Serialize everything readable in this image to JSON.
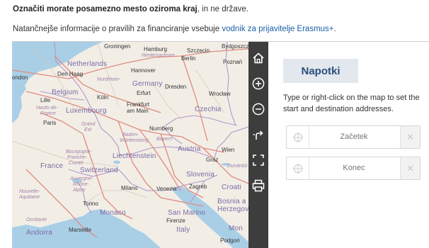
{
  "intro": {
    "bold_text": "Označiti morate posamezno mesto oziroma kraj",
    "rest_text": ", in ne države.",
    "info_prefix": "Natančnejše informacije o pravilih za financiranje vsebuje ",
    "info_link": "vodnik za prijavitelje Erasmus+",
    "info_suffix": "."
  },
  "map": {
    "countries": [
      "Netherlands",
      "Belgium",
      "Luxembourg",
      "Germany",
      "France",
      "Switzerland",
      "Liechtenstein",
      "Austria",
      "Czechia",
      "Slovenia",
      "Croatia",
      "Bosnia and Herzegovina",
      "Italy",
      "Monaco",
      "San Marino",
      "Andorra"
    ],
    "cities": [
      "Groningen",
      "Hamburg",
      "Szczecin",
      "Bydgoszcz",
      "Berlin",
      "Poznań",
      "Den Haag",
      "Hannover",
      "London",
      "Dresden",
      "Wrocław",
      "Lille",
      "Köln",
      "Erfurt",
      "Frankfurt am Main",
      "Paris",
      "Nürnberg",
      "Wien",
      "Graz",
      "Zagreb",
      "Milano",
      "Venezia",
      "Torino",
      "Firenze",
      "Marseille",
      "Podgorica"
    ],
    "regions": [
      "Niedersachsen",
      "Nordrhein-Westfalen",
      "Hauts-de-France",
      "Grand Est",
      "Baden-Württemberg",
      "Bayern",
      "Bourgogne-Franche-Comté",
      "Auvergne-Rhône-Alpes",
      "Nouvelle-Aquitaine",
      "Occitanie",
      "Dunántúl"
    ],
    "labels": {
      "groningen": "Groningen",
      "hamburg": "Hamburg",
      "szczecin": "Szczecin",
      "bydgoszcz": "Bydgoszcz",
      "niedersachsen": "Niedersachsen",
      "berlin": "Berlin",
      "poznan": "Poznań",
      "netherlands": "Netherlands",
      "den_haag": "Den Haag",
      "hannover": "Hannover",
      "london": "ondon",
      "nrw": "Nordrhein-",
      "germany": "Germany",
      "dresden": "Dresden",
      "belgium": "Belgium",
      "lille": "Lille",
      "koln": "Köln",
      "erfurt": "Erfurt",
      "wroclaw": "Wrocław",
      "hauts": "Hauts-de-",
      "hauts2": "France",
      "luxembourg": "Luxembourg",
      "frankfurt": "Frankfurt",
      "frankfurt2": "am Main",
      "czechia": "Czechia",
      "paris": "Paris",
      "grand_est": "Grand",
      "grand_est2": "Est",
      "nurnberg": "Nurnberg",
      "baden": "Baden-",
      "baden2": "Württemberg",
      "bayern": "Bayern",
      "wien": "Wien",
      "bourgogne": "Bourgogne-",
      "bourgogne2": "Franche-",
      "bourgogne3": "Comté",
      "liechtenstein": "Liechtenstein",
      "austria": "Austria",
      "france": "France",
      "switzerland": "Switzerland",
      "graz": "Graz",
      "dunantul": "Dunántúl",
      "slovenia": "Slovenia",
      "auvergne": "Auvergne-",
      "auvergne2": "Rhône-",
      "auvergne3": "Alpes",
      "nouvelle": "Nouvelle-",
      "nouvelle2": "Aquitaine",
      "milano": "Milano",
      "venezia": "Venezia",
      "zagreb": "Zagreb",
      "croatia": "Croati",
      "torino": "Torino",
      "bosnia": "Bosnia a",
      "bosnia2": "Herzegov",
      "monaco": "Monaco",
      "san_marino": "San Marino",
      "firenze": "Firenze",
      "occitanie": "Occitanie",
      "italy": "Italy",
      "andorra": "Andorra",
      "marseille": "Marseille",
      "montenegro": "Mon",
      "podgorica": "Podgori"
    }
  },
  "toolbar": {
    "buttons": [
      {
        "name": "home",
        "icon": "home-icon"
      },
      {
        "name": "zoom_in",
        "icon": "zoom-in-icon"
      },
      {
        "name": "zoom_out",
        "icon": "zoom-out-icon"
      },
      {
        "name": "route",
        "icon": "route-icon"
      },
      {
        "name": "fullscreen",
        "icon": "fullscreen-icon"
      },
      {
        "name": "print",
        "icon": "print-icon"
      }
    ]
  },
  "panel": {
    "tab_label": "Napotki",
    "hint": "Type or right-click on the map to set the start and destination addresses.",
    "start": {
      "placeholder": "Začetek",
      "value": ""
    },
    "end": {
      "placeholder": "Konec",
      "value": ""
    },
    "clear_symbol": "✕"
  },
  "colors": {
    "link": "#1a5fa8",
    "toolbar_bg": "#3d3d3d",
    "tab_bg": "#e3e8ee",
    "tab_text": "#2c4e7c",
    "sea": "#a9cfe6",
    "land": "#f2eee6",
    "highway": "#e08a7e",
    "border": "#b497c8"
  }
}
